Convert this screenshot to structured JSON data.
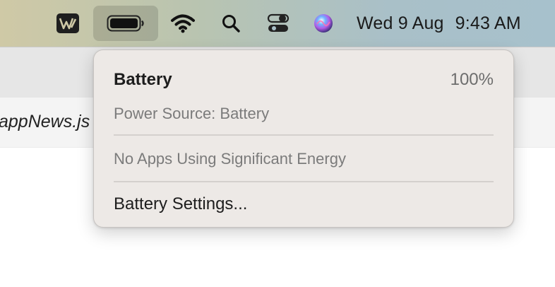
{
  "menubar": {
    "icons": [
      "wps-office-icon",
      "battery-icon",
      "wifi-icon",
      "spotlight-search-icon",
      "control-center-icon",
      "siri-icon"
    ],
    "date": "Wed 9 Aug",
    "time": "9:43 AM"
  },
  "background_window": {
    "filename": "appNews.js"
  },
  "battery_menu": {
    "title": "Battery",
    "percent": "100%",
    "power_source": "Power Source: Battery",
    "energy_status": "No Apps Using Significant Energy",
    "settings_label": "Battery Settings..."
  },
  "colors": {
    "popup_bg": "#ede9e6",
    "menubar_left": "#cfc9a6",
    "menubar_right": "#a7c1cc"
  }
}
